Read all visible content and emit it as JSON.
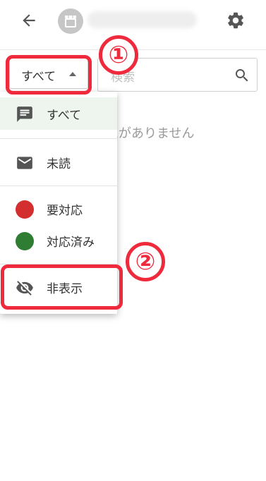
{
  "header": {
    "back_icon": "arrow-back-icon",
    "avatar_icon": "storefront-icon",
    "settings_icon": "gear-icon"
  },
  "filter": {
    "label": "すべて",
    "caret_icon": "caret-up-icon"
  },
  "search": {
    "placeholder": "検索",
    "icon": "search-icon"
  },
  "empty_message": "ムがありません",
  "dropdown": {
    "items": [
      {
        "label": "すべて",
        "icon": "chat-icon",
        "selected": true
      },
      {
        "label": "未読",
        "icon": "mail-icon"
      },
      {
        "label": "要対応",
        "icon": "red-dot-icon",
        "color": "#d32f2f"
      },
      {
        "label": "対応済み",
        "icon": "green-dot-icon",
        "color": "#2e7d32"
      },
      {
        "label": "非表示",
        "icon": "visibility-off-icon"
      }
    ]
  },
  "annotations": {
    "step1": "①",
    "step2": "②",
    "color": "#ee2a3c"
  }
}
